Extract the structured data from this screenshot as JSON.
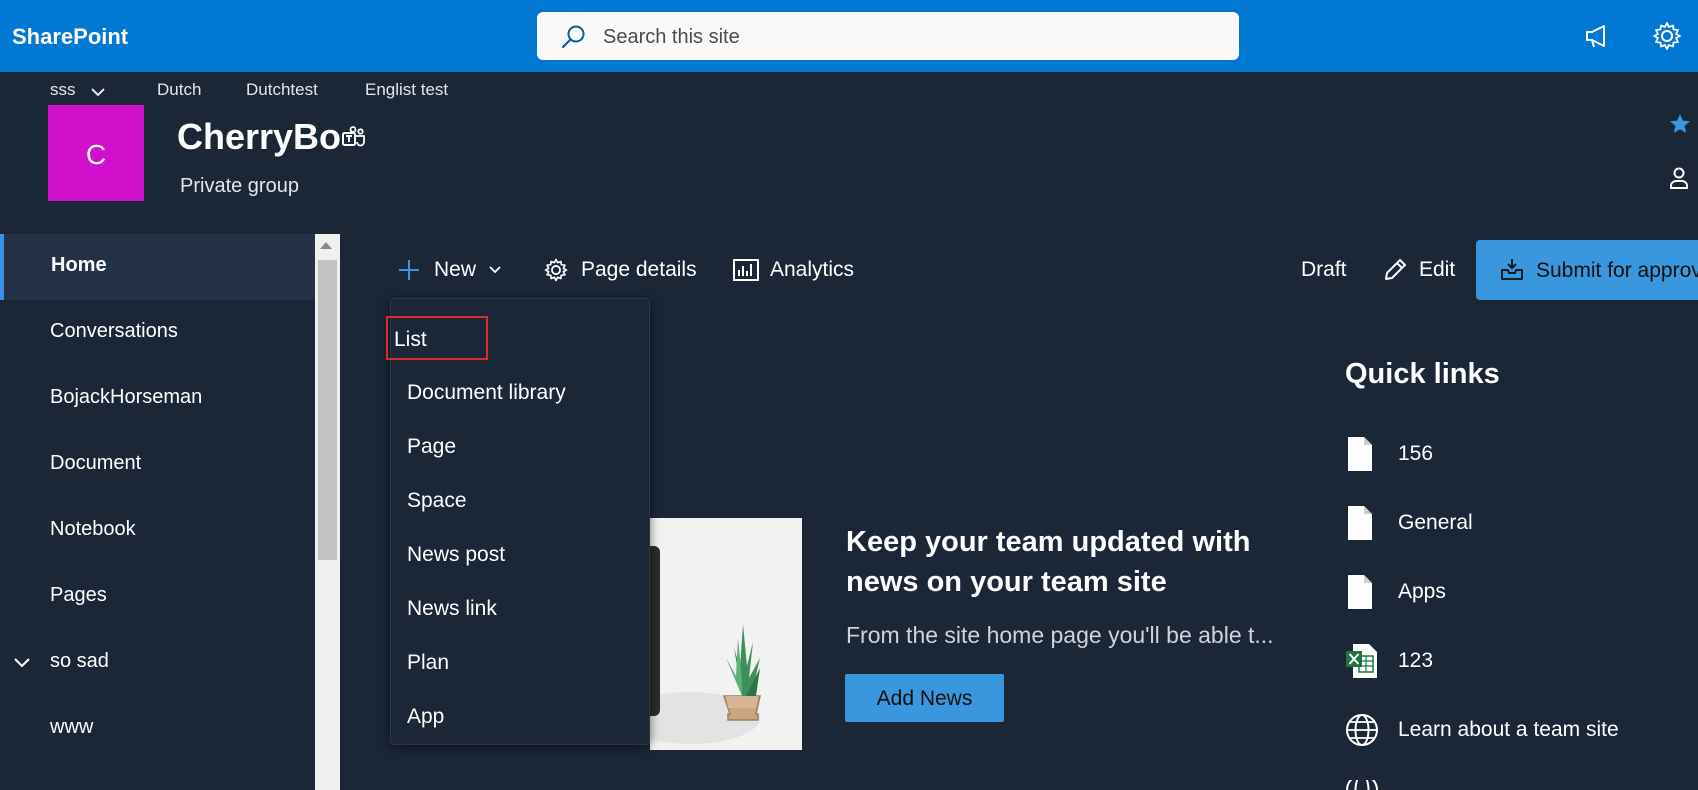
{
  "app": {
    "name": "SharePoint"
  },
  "search": {
    "placeholder": "Search this site"
  },
  "hub_nav": {
    "items": [
      "sss",
      "Dutch",
      "Dutchtest",
      "Englist test"
    ]
  },
  "site": {
    "logo_letter": "C",
    "logo_color": "#d20fcb",
    "title": "CherryBo",
    "subtitle": "Private group"
  },
  "left_nav": {
    "items": [
      {
        "label": "Home",
        "active": true
      },
      {
        "label": "Conversations"
      },
      {
        "label": "BojackHorseman"
      },
      {
        "label": "Document"
      },
      {
        "label": "Notebook"
      },
      {
        "label": "Pages"
      },
      {
        "label": "so sad",
        "expandable": true
      },
      {
        "label": "www"
      }
    ]
  },
  "command_bar": {
    "new_label": "New",
    "page_details_label": "Page details",
    "analytics_label": "Analytics",
    "status_label": "Draft",
    "edit_label": "Edit",
    "submit_label": "Submit for approval"
  },
  "new_menu": {
    "items": [
      "List",
      "Document library",
      "Page",
      "Space",
      "News post",
      "News link",
      "Plan",
      "App"
    ],
    "highlighted": "List"
  },
  "news": {
    "title": "Keep your team updated with news on your team site",
    "subtitle": "From the site home page you'll be able t...",
    "button_label": "Add News"
  },
  "quick_links": {
    "title": "Quick links",
    "items": [
      {
        "label": "156",
        "icon": "file-icon"
      },
      {
        "label": "General",
        "icon": "file-icon"
      },
      {
        "label": "Apps",
        "icon": "file-icon"
      },
      {
        "label": "123",
        "icon": "excel-icon"
      },
      {
        "label": "Learn about a team site",
        "icon": "globe-icon"
      }
    ]
  },
  "colors": {
    "brand": "#0178d4",
    "background": "#1b2637",
    "accent": "#3a96dd",
    "highlight_border": "#e0282e"
  }
}
